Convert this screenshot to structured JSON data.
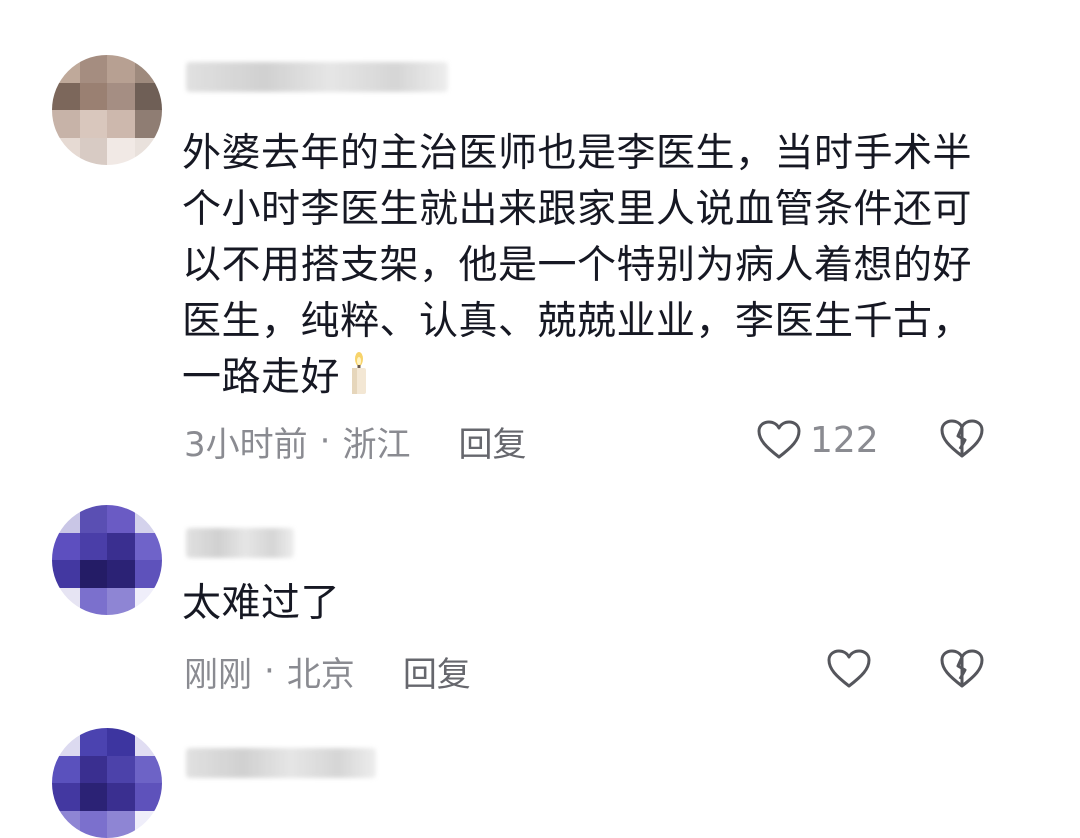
{
  "comments": [
    {
      "text": "外婆去年的主治医师也是李医生，当时手术半个小时李医生就出来跟家里人说血管条件还可以不用搭支架，他是一个特别为病人着想的好医生，纯粹、认真、兢兢业业，李医生千古，一路走好",
      "time": "3小时前",
      "separator": "·",
      "location": "浙江",
      "reply_label": "回复",
      "like_count": "122",
      "like_icon": "heart-outline-icon",
      "dislike_icon": "broken-heart-icon",
      "emoji": "candle-emoji"
    },
    {
      "text": "太难过了",
      "time": "刚刚",
      "separator": "·",
      "location": "北京",
      "reply_label": "回复",
      "like_count": "",
      "like_icon": "heart-outline-icon",
      "dislike_icon": "broken-heart-icon"
    }
  ],
  "colors": {
    "text": "#161823",
    "meta": "#8a8b91",
    "icon": "#55565c"
  }
}
